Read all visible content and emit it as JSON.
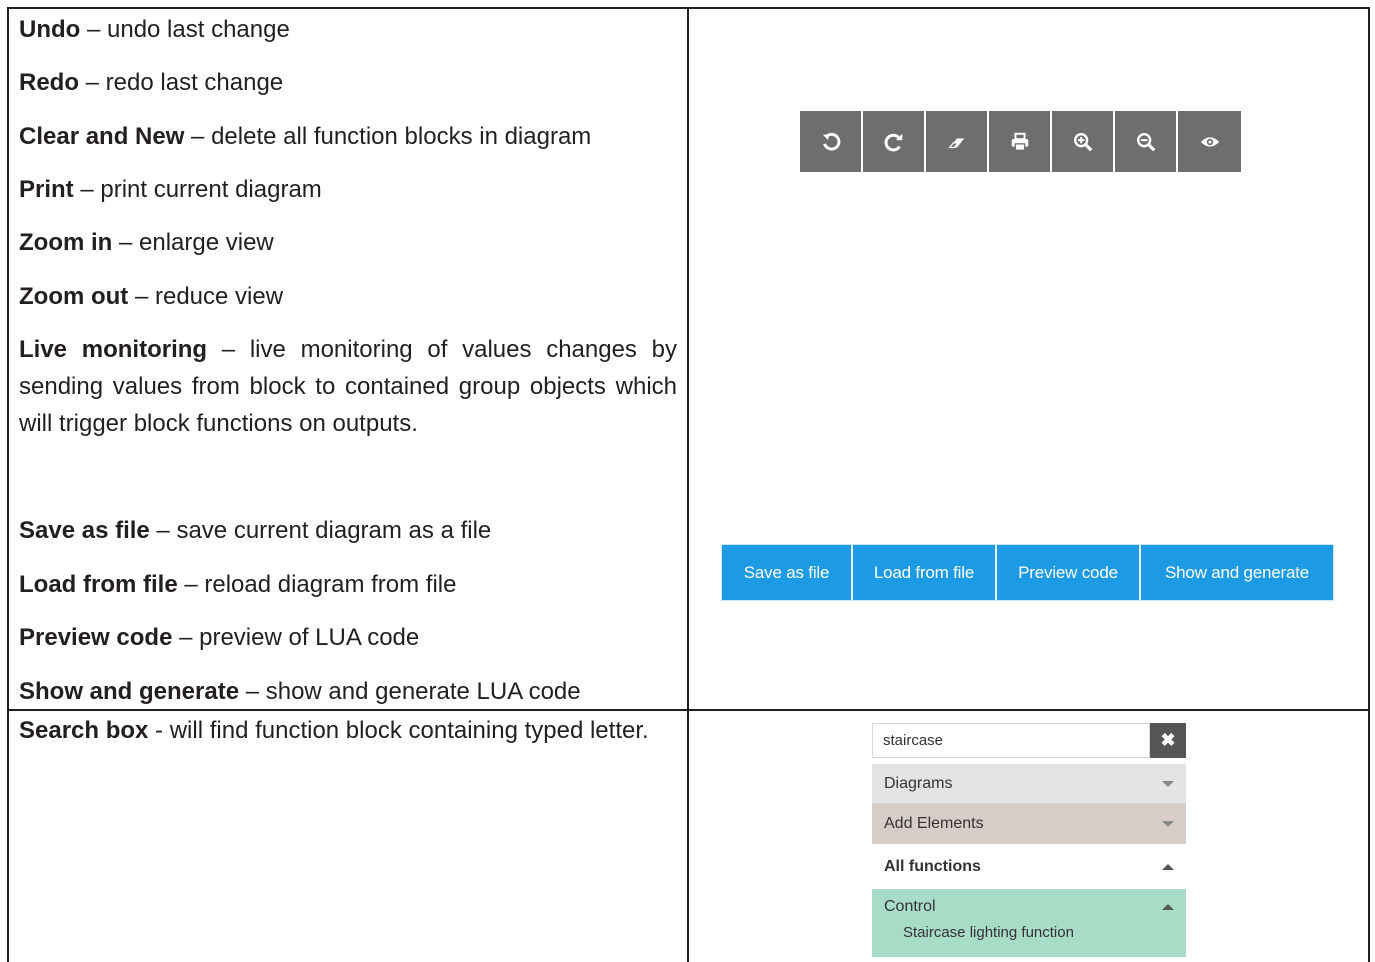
{
  "rows": {
    "undo": {
      "term": "Undo",
      "desc": " – undo last change"
    },
    "redo": {
      "term": "Redo",
      "desc": " – redo last change"
    },
    "clear": {
      "term": "Clear and New",
      "desc": " – delete all function blocks in diagram"
    },
    "print": {
      "term": "Print",
      "desc": " – print current diagram"
    },
    "zoom_in": {
      "term": "Zoom in",
      "desc": " – enlarge view"
    },
    "zoom_out": {
      "term": "Zoom out",
      "desc": " – reduce view"
    },
    "live": {
      "term": "Live monitoring",
      "desc": " – live monitoring of values changes by sending values from block to contained group objects which will trigger block functions on outputs."
    },
    "save": {
      "term": "Save as file",
      "desc": " – save current diagram as a file"
    },
    "load": {
      "term": "Load from file",
      "desc": " – reload diagram from file"
    },
    "preview": {
      "term": "Preview code",
      "desc": " – preview of LUA code"
    },
    "show": {
      "term": "Show and generate",
      "desc": " – show and generate LUA code"
    },
    "search": {
      "term": "Search box",
      "desc": " - will find function block containing typed letter."
    }
  },
  "toolbar": {
    "icons": [
      "undo-icon",
      "redo-icon",
      "eraser-icon",
      "print-icon",
      "zoom-in-icon",
      "zoom-out-icon",
      "eye-icon"
    ],
    "color": "#6e6e6e"
  },
  "buttons": {
    "save_label": "Save as file",
    "load_label": "Load from file",
    "preview_label": "Preview code",
    "show_label": "Show and generate",
    "color": "#1c9be4"
  },
  "search_panel": {
    "value": "staircase",
    "clear_icon": "close-icon",
    "diagrams": "Diagrams",
    "add_elements": "Add Elements",
    "all_functions": "All functions",
    "control": "Control",
    "control_item": "Staircase lighting function",
    "colors": {
      "diagrams": "#e4e4e4",
      "add_elements": "#d8ccc8",
      "control": "#a9dcc6"
    }
  }
}
